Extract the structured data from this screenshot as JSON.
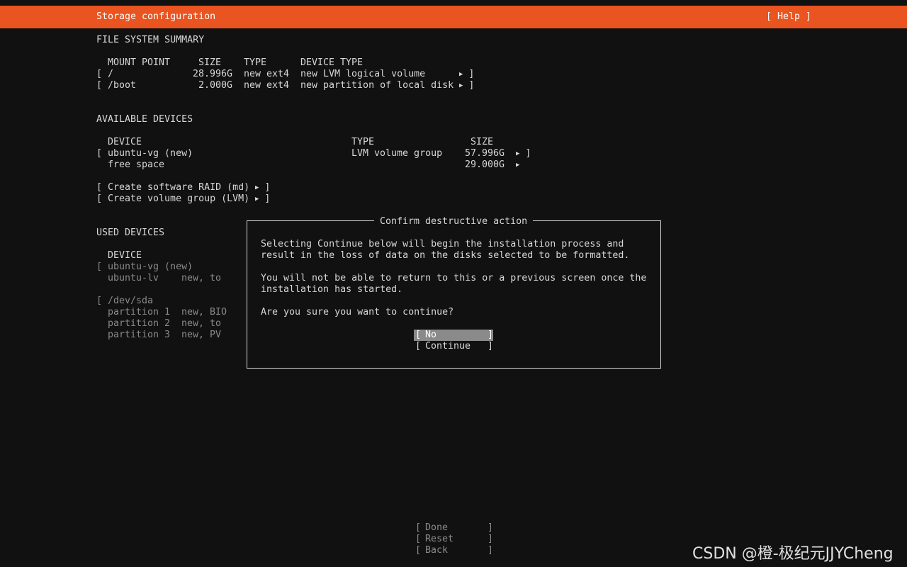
{
  "header": {
    "title": "Storage configuration",
    "help_label": "[ Help ]"
  },
  "fs_summary": {
    "heading": "FILE SYSTEM SUMMARY",
    "columns": {
      "mount": "MOUNT POINT",
      "size": "SIZE",
      "type": "TYPE",
      "device_type": "DEVICE TYPE"
    },
    "rows": [
      {
        "mount": "/",
        "size": "28.996G",
        "type": "new ext4",
        "device_type": "new LVM logical volume"
      },
      {
        "mount": "/boot",
        "size": "2.000G",
        "type": "new ext4",
        "device_type": "new partition of local disk"
      }
    ]
  },
  "available": {
    "heading": "AVAILABLE DEVICES",
    "columns": {
      "device": "DEVICE",
      "type": "TYPE",
      "size": "SIZE"
    },
    "rows": [
      {
        "device": "ubuntu-vg (new)",
        "type": "LVM volume group",
        "size": "57.996G"
      },
      {
        "device": "free space",
        "type": "",
        "size": "29.000G"
      }
    ],
    "create_raid": "Create software RAID (md)",
    "create_lvm": "Create volume group (LVM)"
  },
  "used": {
    "heading": "USED DEVICES",
    "column_device": "DEVICE",
    "rows": [
      {
        "name": "ubuntu-vg (new)",
        "info": ""
      },
      {
        "name": "ubuntu-lv",
        "info": "new, to"
      },
      {
        "name": "/dev/sda",
        "info": ""
      },
      {
        "name": "partition 1",
        "info": "new, BIO"
      },
      {
        "name": "partition 2",
        "info": "new, to"
      },
      {
        "name": "partition 3",
        "info": "new, PV"
      }
    ]
  },
  "dialog": {
    "title": "Confirm destructive action",
    "line1": "Selecting Continue below will begin the installation process and",
    "line2": "result in the loss of data on the disks selected to be formatted.",
    "line3": "You will not be able to return to this or a previous screen once the",
    "line4": "installation has started.",
    "question": "Are you sure you want to continue?",
    "no_label": "No",
    "continue_label": "Continue"
  },
  "footer": {
    "done": "Done",
    "reset": "Reset",
    "back": "Back"
  },
  "watermark": "CSDN @橙-极纪元JJYCheng",
  "colors": {
    "accent": "#e95420",
    "background": "#111111",
    "text": "#d7d7d7",
    "selected": "#8a8a8a"
  }
}
